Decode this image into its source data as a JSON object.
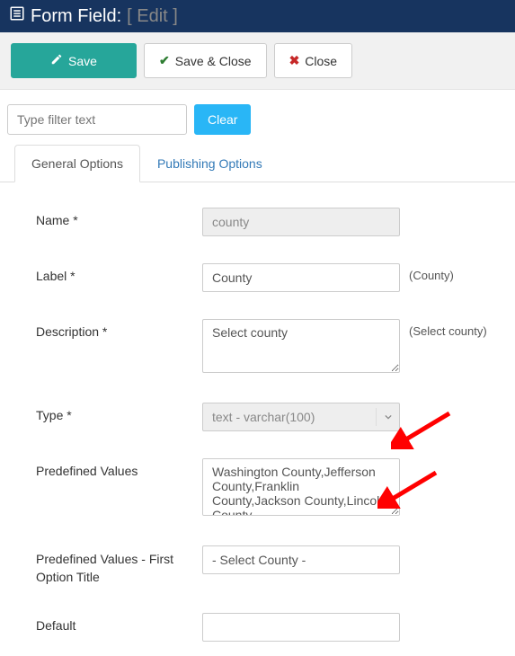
{
  "header": {
    "icon": "list-icon",
    "title": "Form Field:",
    "subtitle": "[ Edit ]"
  },
  "toolbar": {
    "save": "Save",
    "save_close": "Save & Close",
    "close": "Close"
  },
  "filter": {
    "placeholder": "Type filter text",
    "clear": "Clear"
  },
  "tabs": {
    "general": "General Options",
    "publishing": "Publishing Options"
  },
  "form": {
    "name_label": "Name *",
    "name_value": "county",
    "label_label": "Label *",
    "label_value": "County",
    "label_hint": "(County)",
    "desc_label": "Description *",
    "desc_value": "Select county",
    "desc_hint": "(Select county)",
    "type_label": "Type *",
    "type_value": "text - varchar(100)",
    "predef_label": "Predefined Values",
    "predef_value": "Washington County,Jefferson County,Franklin County,Jackson County,Lincoln County",
    "first_label": "Predefined Values - First Option Title",
    "first_value": "- Select County -",
    "default_label": "Default",
    "default_value": ""
  }
}
